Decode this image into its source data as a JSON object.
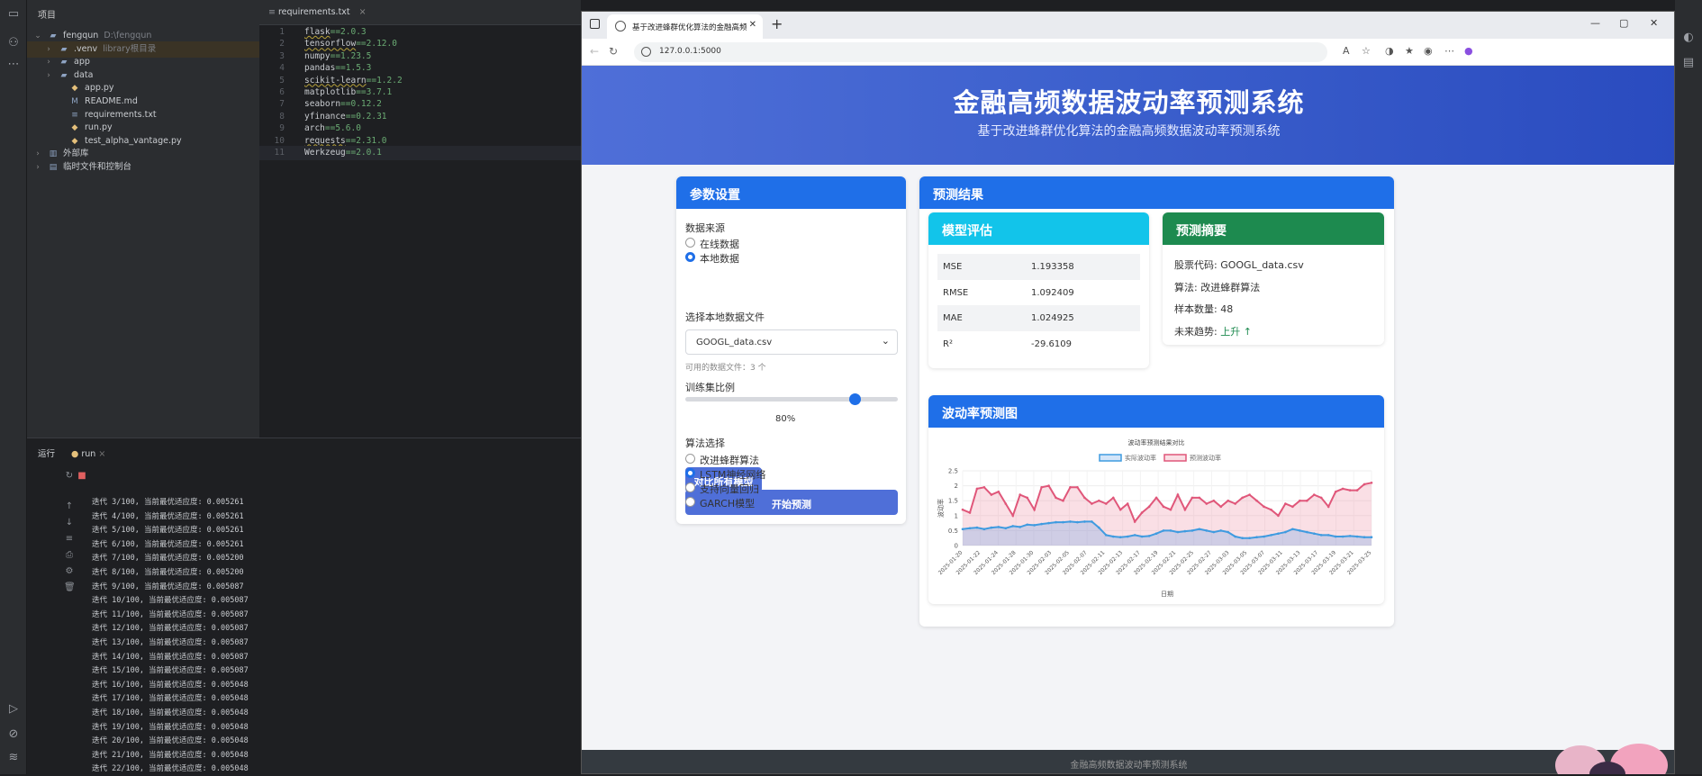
{
  "ide": {
    "project_label": "项目",
    "tree": [
      {
        "name": "fengqun",
        "extra": "D:\\fengqun",
        "depth": 0,
        "icon": "folder-icon",
        "expanded": true
      },
      {
        "name": ".venv",
        "extra": "library根目录",
        "depth": 1,
        "icon": "folder-icon",
        "selected": true
      },
      {
        "name": "app",
        "extra": "",
        "depth": 1,
        "icon": "folder-icon"
      },
      {
        "name": "data",
        "extra": "",
        "depth": 1,
        "icon": "folder-icon"
      },
      {
        "name": "app.py",
        "extra": "",
        "depth": 2,
        "icon": "python-file-icon"
      },
      {
        "name": "README.md",
        "extra": "",
        "depth": 2,
        "icon": "markdown-file-icon"
      },
      {
        "name": "requirements.txt",
        "extra": "",
        "depth": 2,
        "icon": "text-file-icon"
      },
      {
        "name": "run.py",
        "extra": "",
        "depth": 2,
        "icon": "python-file-icon"
      },
      {
        "name": "test_alpha_vantage.py",
        "extra": "",
        "depth": 2,
        "icon": "python-file-icon"
      },
      {
        "name": "外部库",
        "extra": "",
        "depth": 0,
        "icon": "library-icon"
      },
      {
        "name": "临时文件和控制台",
        "extra": "",
        "depth": 0,
        "icon": "console-icon"
      }
    ],
    "editor_tab": "requirements.txt",
    "code": [
      {
        "n": "1",
        "pkg": "flask",
        "ver": "==2.0.3",
        "warn": true
      },
      {
        "n": "2",
        "pkg": "tensorflow",
        "ver": "==2.12.0",
        "warn": true
      },
      {
        "n": "3",
        "pkg": "numpy",
        "ver": "==1.23.5"
      },
      {
        "n": "4",
        "pkg": "pandas",
        "ver": "==1.5.3"
      },
      {
        "n": "5",
        "pkg": "scikit-learn",
        "ver": "==1.2.2",
        "warn": true
      },
      {
        "n": "6",
        "pkg": "matplotlib",
        "ver": "==3.7.1"
      },
      {
        "n": "7",
        "pkg": "seaborn",
        "ver": "==0.12.2"
      },
      {
        "n": "8",
        "pkg": "yfinance",
        "ver": "==0.2.31"
      },
      {
        "n": "9",
        "pkg": "arch",
        "ver": "==5.6.0"
      },
      {
        "n": "10",
        "pkg": "requests",
        "ver": "==2.31.0",
        "warn": true
      },
      {
        "n": "11",
        "pkg": "Werkzeug",
        "ver": "==2.0.1",
        "current": true
      }
    ],
    "run_label": "运行",
    "run_tab": "run",
    "log": [
      "迭代 3/100, 当前最优适应度: 0.005261",
      "迭代 4/100, 当前最优适应度: 0.005261",
      "迭代 5/100, 当前最优适应度: 0.005261",
      "迭代 6/100, 当前最优适应度: 0.005261",
      "迭代 7/100, 当前最优适应度: 0.005200",
      "迭代 8/100, 当前最优适应度: 0.005200",
      "迭代 9/100, 当前最优适应度: 0.005087",
      "迭代 10/100, 当前最优适应度: 0.005087",
      "迭代 11/100, 当前最优适应度: 0.005087",
      "迭代 12/100, 当前最优适应度: 0.005087",
      "迭代 13/100, 当前最优适应度: 0.005087",
      "迭代 14/100, 当前最优适应度: 0.005087",
      "迭代 15/100, 当前最优适应度: 0.005087",
      "迭代 16/100, 当前最优适应度: 0.005048",
      "迭代 17/100, 当前最优适应度: 0.005048",
      "迭代 18/100, 当前最优适应度: 0.005048",
      "迭代 19/100, 当前最优适应度: 0.005048",
      "迭代 20/100, 当前最优适应度: 0.005048",
      "迭代 21/100, 当前最优适应度: 0.005048",
      "迭代 22/100, 当前最优适应度: 0.005048"
    ]
  },
  "browser": {
    "tab_title": "基于改进蜂群优化算法的金融高频",
    "url": "127.0.0.1:5000"
  },
  "page": {
    "title": "金融高频数据波动率预测系统",
    "subtitle": "基于改进蜂群优化算法的金融高频数据波动率预测系统",
    "params": {
      "header": "参数设置",
      "source_label": "数据来源",
      "source_options": [
        {
          "label": "在线数据",
          "checked": false
        },
        {
          "label": "本地数据",
          "checked": true
        }
      ],
      "file_label": "选择本地数据文件",
      "file_value": "GOOGL_data.csv",
      "file_hint": "可用的数据文件：3 个",
      "ratio_label": "训练集比例",
      "ratio_value": "80%",
      "ratio_fraction": 0.8,
      "algo_label": "算法选择",
      "algo_options": [
        {
          "label": "改进蜂群算法",
          "checked": false
        },
        {
          "label": "LSTM神经网络",
          "checked": true
        },
        {
          "label": "支持向量回归",
          "checked": false
        },
        {
          "label": "GARCH模型",
          "checked": false
        }
      ],
      "compare_button": "对比所有模型",
      "predict_button": "开始预测"
    },
    "results": {
      "header": "预测结果",
      "eval_header": "模型评估",
      "metrics": [
        {
          "k": "MSE",
          "v": "1.193358"
        },
        {
          "k": "RMSE",
          "v": "1.092409"
        },
        {
          "k": "MAE",
          "v": "1.024925"
        },
        {
          "k": "R²",
          "v": "-29.6109"
        }
      ],
      "summary_header": "预测摘要",
      "summary": [
        {
          "k": "股票代码: ",
          "v": "GOOGL_data.csv"
        },
        {
          "k": "算法: ",
          "v": "改进蜂群算法"
        },
        {
          "k": "样本数量: ",
          "v": "48"
        },
        {
          "k": "未来趋势: ",
          "v": "上升 ↑"
        }
      ],
      "chart_header": "波动率预测图"
    },
    "footer": "金融高频数据波动率预测系统"
  },
  "chart_data": {
    "type": "area",
    "title": "波动率预测结果对比",
    "xlabel": "日期",
    "ylabel": "波动率",
    "ylim": [
      0,
      2.5
    ],
    "yticks": [
      "0",
      "0.5",
      "1",
      "1.5",
      "2",
      "2.5"
    ],
    "legend_position": "top",
    "grid": true,
    "x": [
      "2025-01-20",
      "2025-01-22",
      "2025-01-24",
      "2025-01-28",
      "2025-01-30",
      "2025-02-03",
      "2025-02-05",
      "2025-02-07",
      "2025-02-11",
      "2025-02-13",
      "2025-02-17",
      "2025-02-19",
      "2025-02-21",
      "2025-02-25",
      "2025-02-27",
      "2025-03-03",
      "2025-03-05",
      "2025-03-07",
      "2025-03-11",
      "2025-03-13",
      "2025-03-17",
      "2025-03-19",
      "2025-03-21",
      "2025-03-25"
    ],
    "series": [
      {
        "name": "实际波动率",
        "color": "#3f9be0",
        "fill": "rgba(80,150,230,0.25)",
        "values": [
          0.55,
          0.58,
          0.6,
          0.55,
          0.6,
          0.62,
          0.58,
          0.65,
          0.62,
          0.7,
          0.68,
          0.72,
          0.75,
          0.78,
          0.78,
          0.8,
          0.78,
          0.8,
          0.8,
          0.6,
          0.35,
          0.3,
          0.28,
          0.3,
          0.35,
          0.3,
          0.32,
          0.4,
          0.5,
          0.5,
          0.45,
          0.48,
          0.5,
          0.55,
          0.5,
          0.45,
          0.5,
          0.45,
          0.3,
          0.25,
          0.25,
          0.28,
          0.3,
          0.35,
          0.4,
          0.45,
          0.55,
          0.5,
          0.45,
          0.4,
          0.35,
          0.35,
          0.3,
          0.3,
          0.32,
          0.3,
          0.28,
          0.28
        ]
      },
      {
        "name": "预测波动率",
        "color": "#e0577a",
        "fill": "rgba(240,150,170,0.3)",
        "values": [
          1.2,
          1.1,
          1.9,
          1.95,
          1.7,
          1.8,
          1.4,
          1.0,
          1.7,
          1.6,
          1.2,
          1.95,
          2.0,
          1.6,
          1.5,
          1.95,
          1.95,
          1.6,
          1.4,
          1.5,
          1.4,
          1.6,
          1.2,
          1.4,
          0.8,
          1.1,
          1.3,
          1.6,
          1.3,
          1.2,
          1.7,
          1.2,
          1.6,
          1.6,
          1.4,
          1.5,
          1.3,
          1.5,
          1.4,
          1.6,
          1.7,
          1.5,
          1.3,
          1.2,
          1.0,
          1.4,
          1.3,
          1.5,
          1.5,
          1.7,
          1.6,
          1.3,
          1.8,
          1.9,
          1.85,
          1.85,
          2.05,
          2.1
        ]
      }
    ]
  }
}
